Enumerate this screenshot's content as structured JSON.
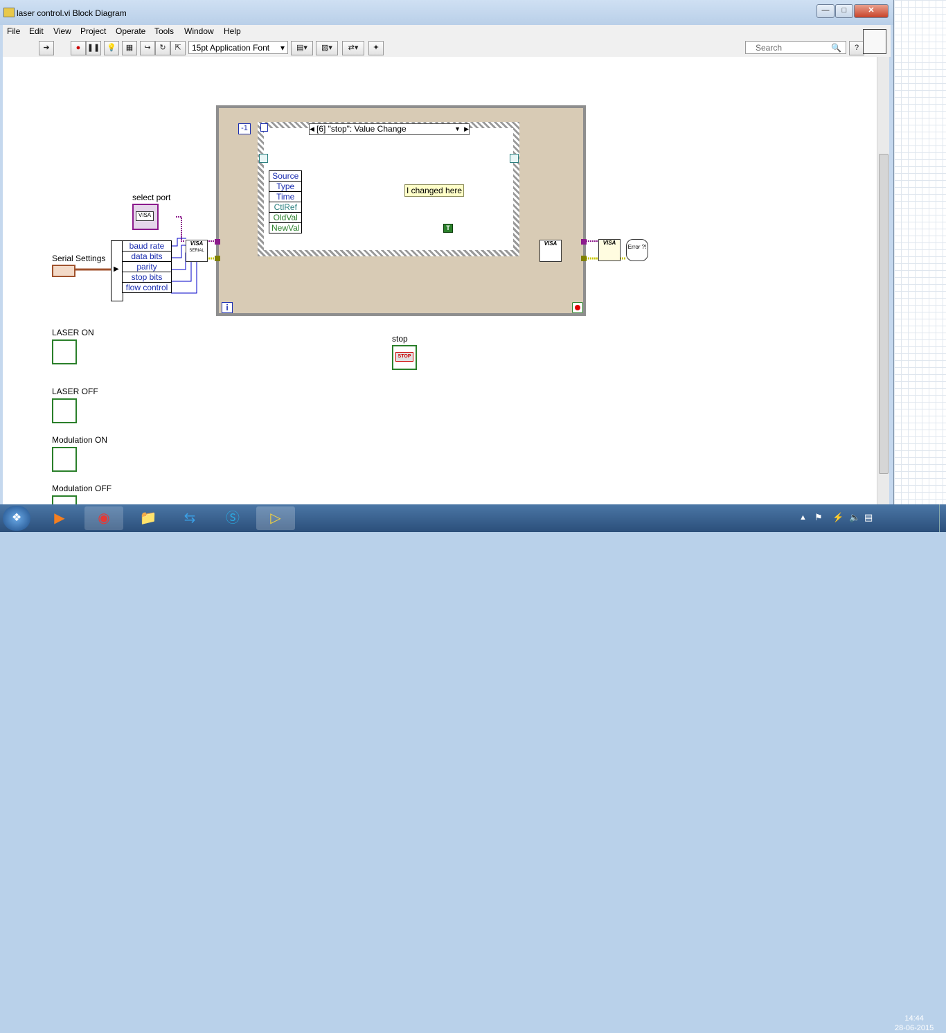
{
  "window": {
    "title": "laser control.vi Block Diagram"
  },
  "menu": [
    "File",
    "Edit",
    "View",
    "Project",
    "Operate",
    "Tools",
    "Window",
    "Help"
  ],
  "toolbar": {
    "font": "15pt Application Font",
    "search_placeholder": "Search",
    "help": "?"
  },
  "diagram": {
    "select_port_label": "select port",
    "serial_settings_label": "Serial Settings",
    "serial_cluster": [
      "baud rate",
      "data bits",
      "parity",
      "stop bits",
      "flow control"
    ],
    "loop_counter": "-1",
    "event_case": "[6] \"stop\": Value Change",
    "event_data": [
      "Source",
      "Type",
      "Time",
      "CtlRef",
      "OldVal",
      "NewVal"
    ],
    "comment": "I changed here",
    "true_const": "T",
    "iteration": "i",
    "controls": [
      {
        "label": "LASER ON"
      },
      {
        "label": "LASER OFF"
      },
      {
        "label": "Modulation ON"
      },
      {
        "label": "Modulation OFF"
      }
    ],
    "stop_label": "stop",
    "stop_button_text": "STOP",
    "visa_text": "VISA",
    "serial_text": "SERIAL",
    "error_text": "Error ?!"
  },
  "taskbar": {
    "time": "14:44",
    "date": "28-06-2015"
  },
  "colors": {
    "wire_purple": "#8c1a8c",
    "wire_error": "#c8c800",
    "bool_green": "#2a7f2a",
    "cluster_brown": "#a0522d",
    "wire_blue": "#0000c8"
  }
}
